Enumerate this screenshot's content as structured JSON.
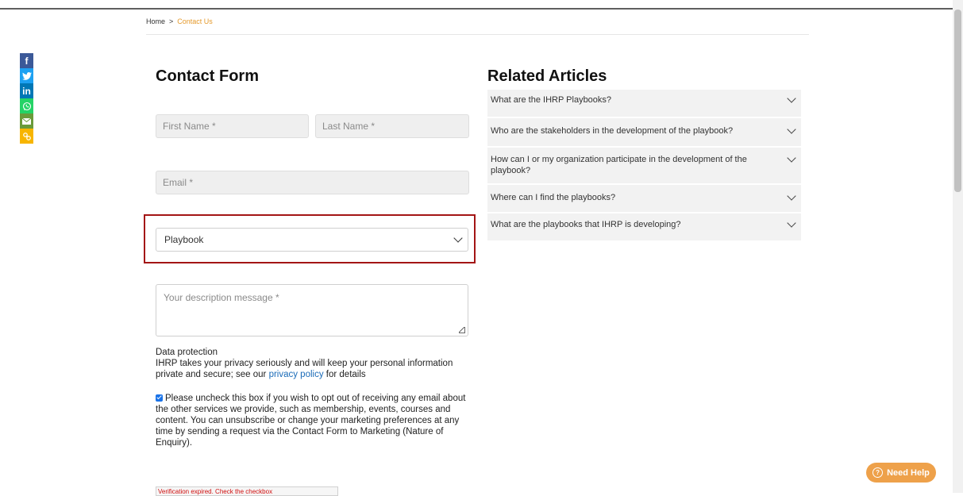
{
  "breadcrumb": {
    "home": "Home",
    "separator": ">",
    "current": "Contact Us"
  },
  "social": {
    "facebook": "f",
    "twitter": "t",
    "linkedin": "in",
    "whatsapp": "w",
    "email": "✉",
    "copy": "⚭"
  },
  "form": {
    "title": "Contact Form",
    "first_name_placeholder": "First Name *",
    "last_name_placeholder": "Last Name *",
    "email_placeholder": "Email *",
    "enquiry_select_value": "Playbook",
    "message_placeholder": "Your description message *",
    "data_protection_title": "Data protection",
    "data_protection_text": "IHRP takes your privacy seriously and will keep your personal information private and secure; see our",
    "privacy_link": "privacy policy",
    "data_protection_suffix": "for details",
    "optin_checked": true,
    "optin_text": "Please uncheck this box if you wish to opt out of receiving any email about the other services we provide, such as membership, events, courses and content. You can unsubscribe or change your marketing preferences at any time by sending a request via the Contact Form to Marketing (Nature of Enquiry).",
    "verification_error": "Verification expired. Check the checkbox"
  },
  "related": {
    "title": "Related Articles",
    "items": [
      {
        "label": "What are the IHRP Playbooks?"
      },
      {
        "label": "Who are the stakeholders in the development of the playbook?"
      },
      {
        "label": "How can I or my organization participate in the development of the playbook?"
      },
      {
        "label": "Where can I find the playbooks?"
      },
      {
        "label": "What are the playbooks that IHRP is developing?"
      }
    ]
  },
  "help_button": {
    "label": "Need Help",
    "icon": "?"
  },
  "colors": {
    "accent": "#e59a2c",
    "highlight": "#a31515",
    "link": "#1a6bb8",
    "help": "#eea14a"
  }
}
